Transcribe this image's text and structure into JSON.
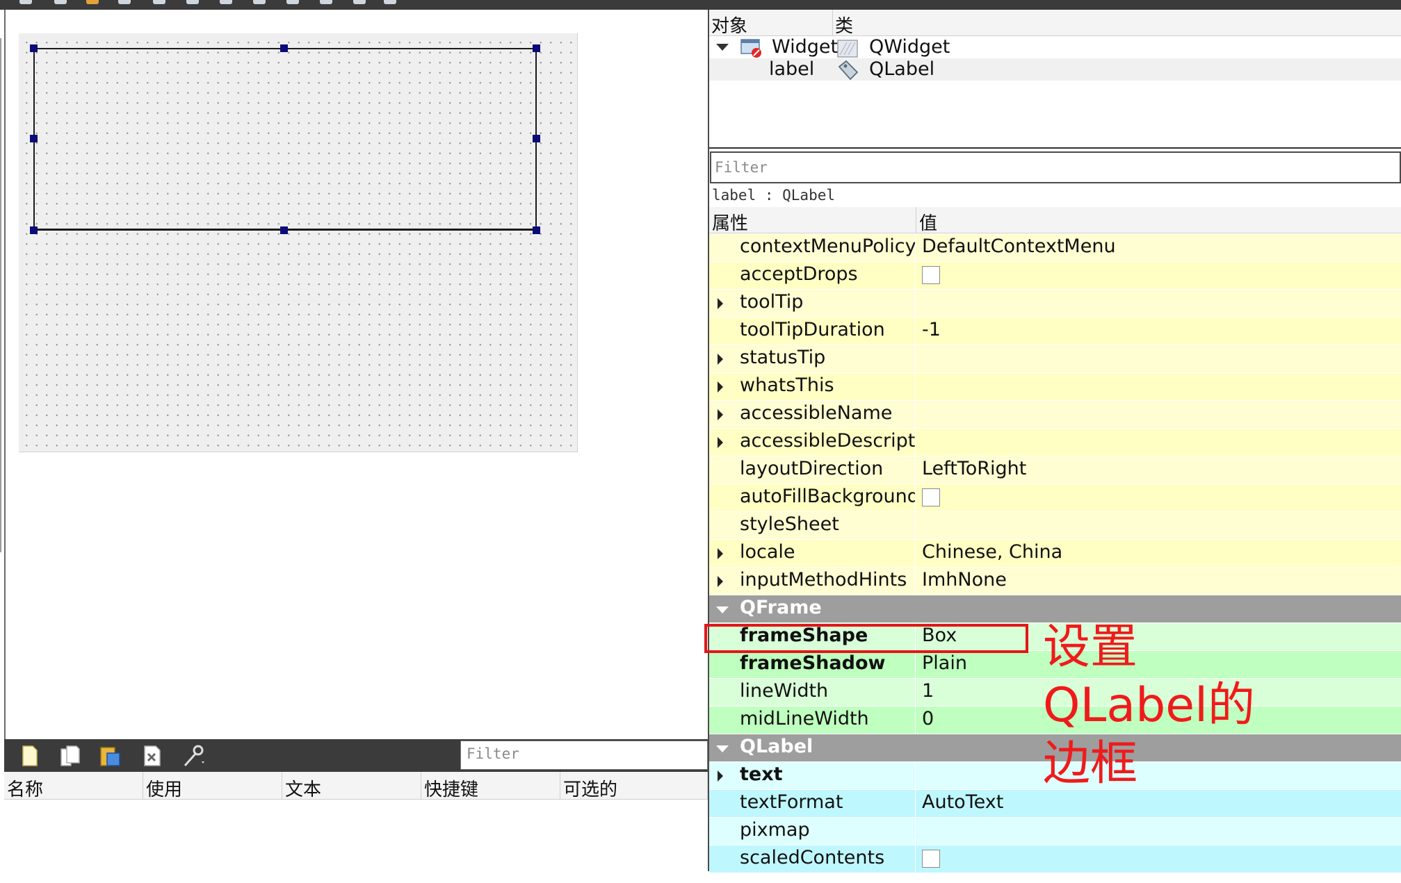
{
  "object_inspector": {
    "header": {
      "object": "对象",
      "class": "类"
    },
    "rows": [
      {
        "object": "Widget",
        "class": "QWidget",
        "expanded": true,
        "icon": "widget-form-icon",
        "class_icon": "qwidget-icon"
      },
      {
        "object": "label",
        "class": "QLabel",
        "icon": "",
        "class_icon": "qlabel-tag-icon"
      }
    ]
  },
  "property_editor": {
    "filter_placeholder": "Filter",
    "current_object": "label : QLabel",
    "header": {
      "property": "属性",
      "value": "值"
    },
    "colors": {
      "qobject_rows": "#fffdd2",
      "qobject_rows_alt": "#ffffc4",
      "qframe_group": "#9e9e9e",
      "qframe_rows": "#d9ffd9",
      "qframe_rows_alt": "#bfffbf",
      "qlabel_rows": "#ddffff",
      "qlabel_rows_alt": "#bff7ff"
    },
    "rows": [
      {
        "name": "contextMenuPolicy",
        "value": "DefaultContextMenu",
        "section": "widget",
        "expandable": false
      },
      {
        "name": "acceptDrops",
        "value": "",
        "checkbox": true,
        "checked": false,
        "section": "widget",
        "expandable": false
      },
      {
        "name": "toolTip",
        "value": "",
        "section": "widget",
        "expandable": true
      },
      {
        "name": "toolTipDuration",
        "value": "-1",
        "section": "widget",
        "expandable": false
      },
      {
        "name": "statusTip",
        "value": "",
        "section": "widget",
        "expandable": true
      },
      {
        "name": "whatsThis",
        "value": "",
        "section": "widget",
        "expandable": true
      },
      {
        "name": "accessibleName",
        "value": "",
        "section": "widget",
        "expandable": true
      },
      {
        "name": "accessibleDescription",
        "value": "",
        "section": "widget",
        "expandable": true
      },
      {
        "name": "layoutDirection",
        "value": "LeftToRight",
        "section": "widget",
        "expandable": false
      },
      {
        "name": "autoFillBackground",
        "value": "",
        "checkbox": true,
        "checked": false,
        "section": "widget",
        "expandable": false
      },
      {
        "name": "styleSheet",
        "value": "",
        "section": "widget",
        "expandable": false
      },
      {
        "name": "locale",
        "value": "Chinese, China",
        "section": "widget",
        "expandable": true
      },
      {
        "name": "inputMethodHints",
        "value": "ImhNone",
        "section": "widget",
        "expandable": true
      },
      {
        "name": "QFrame",
        "group": true
      },
      {
        "name": "frameShape",
        "value": "Box",
        "section": "qframe",
        "bold": true,
        "expandable": false
      },
      {
        "name": "frameShadow",
        "value": "Plain",
        "section": "qframe",
        "bold": true,
        "expandable": false
      },
      {
        "name": "lineWidth",
        "value": "1",
        "section": "qframe",
        "expandable": false
      },
      {
        "name": "midLineWidth",
        "value": "0",
        "section": "qframe",
        "expandable": false
      },
      {
        "name": "QLabel",
        "group": true
      },
      {
        "name": "text",
        "value": "",
        "section": "qlabel",
        "bold": true,
        "expandable": true
      },
      {
        "name": "textFormat",
        "value": "AutoText",
        "section": "qlabel",
        "expandable": false
      },
      {
        "name": "pixmap",
        "value": "",
        "section": "qlabel",
        "expandable": false
      },
      {
        "name": "scaledContents",
        "value": "",
        "checkbox": true,
        "checked": false,
        "section": "qlabel",
        "expandable": false
      }
    ]
  },
  "action_editor": {
    "filter_placeholder": "Filter",
    "toolbar_icons": [
      "new-action-icon",
      "copy-icon",
      "paste-icon",
      "delete-icon",
      "configure-icon"
    ],
    "columns": [
      "名称",
      "使用",
      "文本",
      "快捷键",
      "可选的"
    ]
  },
  "annotation": {
    "lines": [
      "设置",
      "QLabel的",
      "边框"
    ],
    "color": "#ef1b1b"
  }
}
